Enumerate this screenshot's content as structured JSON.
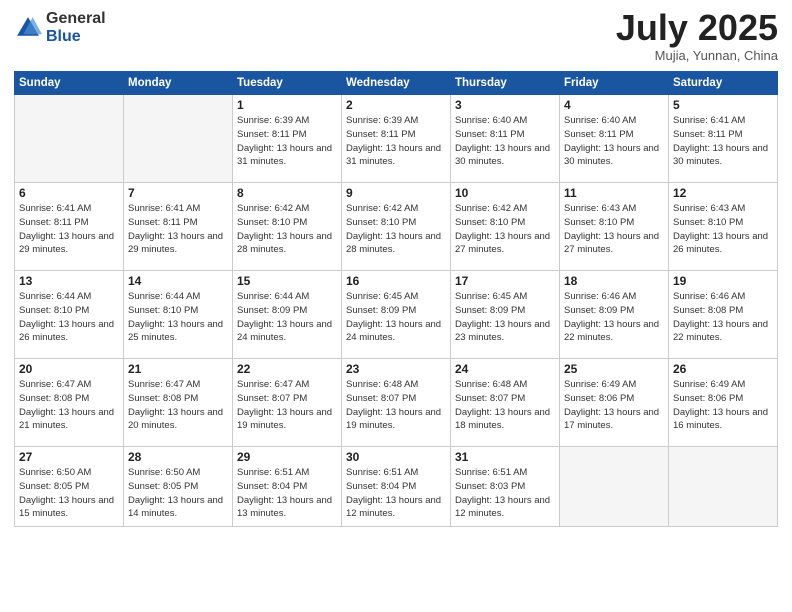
{
  "header": {
    "logo_general": "General",
    "logo_blue": "Blue",
    "title": "July 2025",
    "location": "Mujia, Yunnan, China"
  },
  "weekdays": [
    "Sunday",
    "Monday",
    "Tuesday",
    "Wednesday",
    "Thursday",
    "Friday",
    "Saturday"
  ],
  "weeks": [
    [
      {
        "day": "",
        "detail": ""
      },
      {
        "day": "",
        "detail": ""
      },
      {
        "day": "1",
        "detail": "Sunrise: 6:39 AM\nSunset: 8:11 PM\nDaylight: 13 hours and 31 minutes."
      },
      {
        "day": "2",
        "detail": "Sunrise: 6:39 AM\nSunset: 8:11 PM\nDaylight: 13 hours and 31 minutes."
      },
      {
        "day": "3",
        "detail": "Sunrise: 6:40 AM\nSunset: 8:11 PM\nDaylight: 13 hours and 30 minutes."
      },
      {
        "day": "4",
        "detail": "Sunrise: 6:40 AM\nSunset: 8:11 PM\nDaylight: 13 hours and 30 minutes."
      },
      {
        "day": "5",
        "detail": "Sunrise: 6:41 AM\nSunset: 8:11 PM\nDaylight: 13 hours and 30 minutes."
      }
    ],
    [
      {
        "day": "6",
        "detail": "Sunrise: 6:41 AM\nSunset: 8:11 PM\nDaylight: 13 hours and 29 minutes."
      },
      {
        "day": "7",
        "detail": "Sunrise: 6:41 AM\nSunset: 8:11 PM\nDaylight: 13 hours and 29 minutes."
      },
      {
        "day": "8",
        "detail": "Sunrise: 6:42 AM\nSunset: 8:10 PM\nDaylight: 13 hours and 28 minutes."
      },
      {
        "day": "9",
        "detail": "Sunrise: 6:42 AM\nSunset: 8:10 PM\nDaylight: 13 hours and 28 minutes."
      },
      {
        "day": "10",
        "detail": "Sunrise: 6:42 AM\nSunset: 8:10 PM\nDaylight: 13 hours and 27 minutes."
      },
      {
        "day": "11",
        "detail": "Sunrise: 6:43 AM\nSunset: 8:10 PM\nDaylight: 13 hours and 27 minutes."
      },
      {
        "day": "12",
        "detail": "Sunrise: 6:43 AM\nSunset: 8:10 PM\nDaylight: 13 hours and 26 minutes."
      }
    ],
    [
      {
        "day": "13",
        "detail": "Sunrise: 6:44 AM\nSunset: 8:10 PM\nDaylight: 13 hours and 26 minutes."
      },
      {
        "day": "14",
        "detail": "Sunrise: 6:44 AM\nSunset: 8:10 PM\nDaylight: 13 hours and 25 minutes."
      },
      {
        "day": "15",
        "detail": "Sunrise: 6:44 AM\nSunset: 8:09 PM\nDaylight: 13 hours and 24 minutes."
      },
      {
        "day": "16",
        "detail": "Sunrise: 6:45 AM\nSunset: 8:09 PM\nDaylight: 13 hours and 24 minutes."
      },
      {
        "day": "17",
        "detail": "Sunrise: 6:45 AM\nSunset: 8:09 PM\nDaylight: 13 hours and 23 minutes."
      },
      {
        "day": "18",
        "detail": "Sunrise: 6:46 AM\nSunset: 8:09 PM\nDaylight: 13 hours and 22 minutes."
      },
      {
        "day": "19",
        "detail": "Sunrise: 6:46 AM\nSunset: 8:08 PM\nDaylight: 13 hours and 22 minutes."
      }
    ],
    [
      {
        "day": "20",
        "detail": "Sunrise: 6:47 AM\nSunset: 8:08 PM\nDaylight: 13 hours and 21 minutes."
      },
      {
        "day": "21",
        "detail": "Sunrise: 6:47 AM\nSunset: 8:08 PM\nDaylight: 13 hours and 20 minutes."
      },
      {
        "day": "22",
        "detail": "Sunrise: 6:47 AM\nSunset: 8:07 PM\nDaylight: 13 hours and 19 minutes."
      },
      {
        "day": "23",
        "detail": "Sunrise: 6:48 AM\nSunset: 8:07 PM\nDaylight: 13 hours and 19 minutes."
      },
      {
        "day": "24",
        "detail": "Sunrise: 6:48 AM\nSunset: 8:07 PM\nDaylight: 13 hours and 18 minutes."
      },
      {
        "day": "25",
        "detail": "Sunrise: 6:49 AM\nSunset: 8:06 PM\nDaylight: 13 hours and 17 minutes."
      },
      {
        "day": "26",
        "detail": "Sunrise: 6:49 AM\nSunset: 8:06 PM\nDaylight: 13 hours and 16 minutes."
      }
    ],
    [
      {
        "day": "27",
        "detail": "Sunrise: 6:50 AM\nSunset: 8:05 PM\nDaylight: 13 hours and 15 minutes."
      },
      {
        "day": "28",
        "detail": "Sunrise: 6:50 AM\nSunset: 8:05 PM\nDaylight: 13 hours and 14 minutes."
      },
      {
        "day": "29",
        "detail": "Sunrise: 6:51 AM\nSunset: 8:04 PM\nDaylight: 13 hours and 13 minutes."
      },
      {
        "day": "30",
        "detail": "Sunrise: 6:51 AM\nSunset: 8:04 PM\nDaylight: 13 hours and 12 minutes."
      },
      {
        "day": "31",
        "detail": "Sunrise: 6:51 AM\nSunset: 8:03 PM\nDaylight: 13 hours and 12 minutes."
      },
      {
        "day": "",
        "detail": ""
      },
      {
        "day": "",
        "detail": ""
      }
    ]
  ]
}
